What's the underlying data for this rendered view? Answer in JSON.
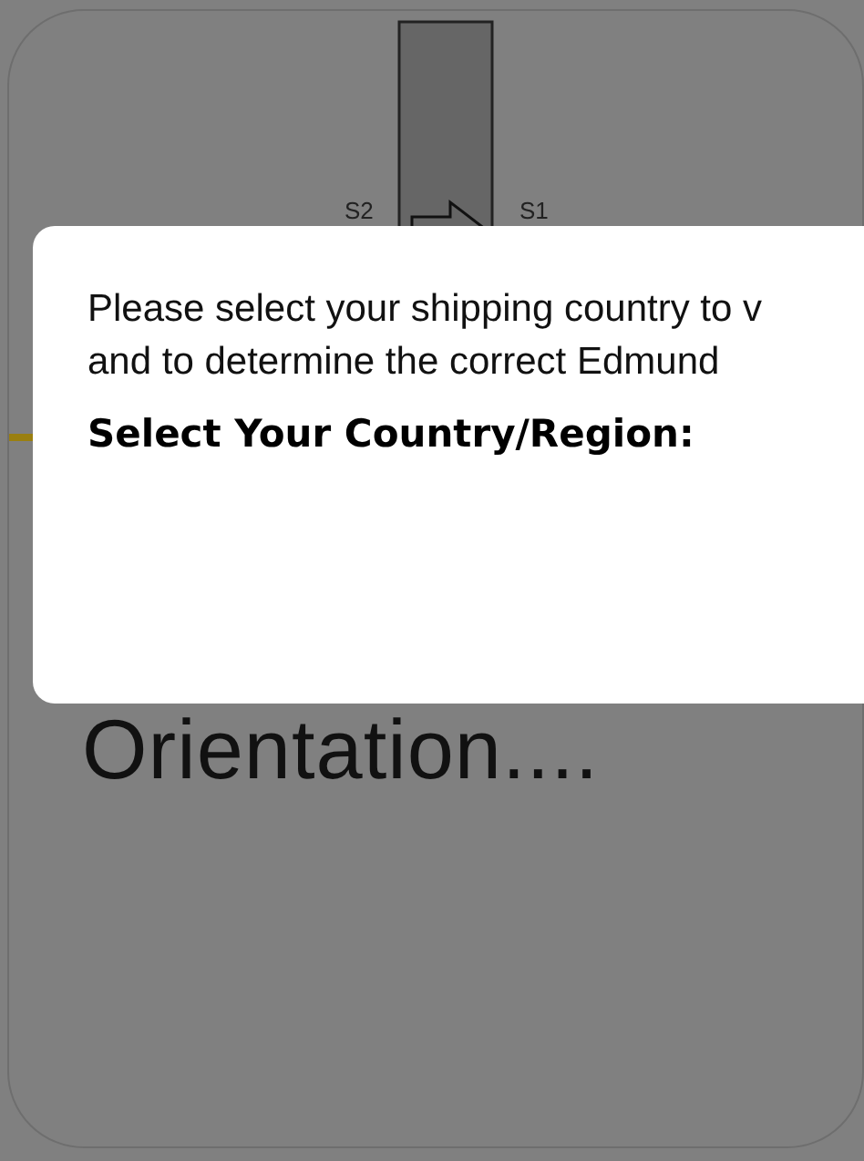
{
  "diagram": {
    "left_label": "S2",
    "right_label": "S1"
  },
  "page_title": "Orientation....",
  "dialog": {
    "lines": [
      "Please select your shipping country to v",
      "and to determine the correct Edmund"
    ],
    "heading": "Select Your Country/Region:"
  }
}
